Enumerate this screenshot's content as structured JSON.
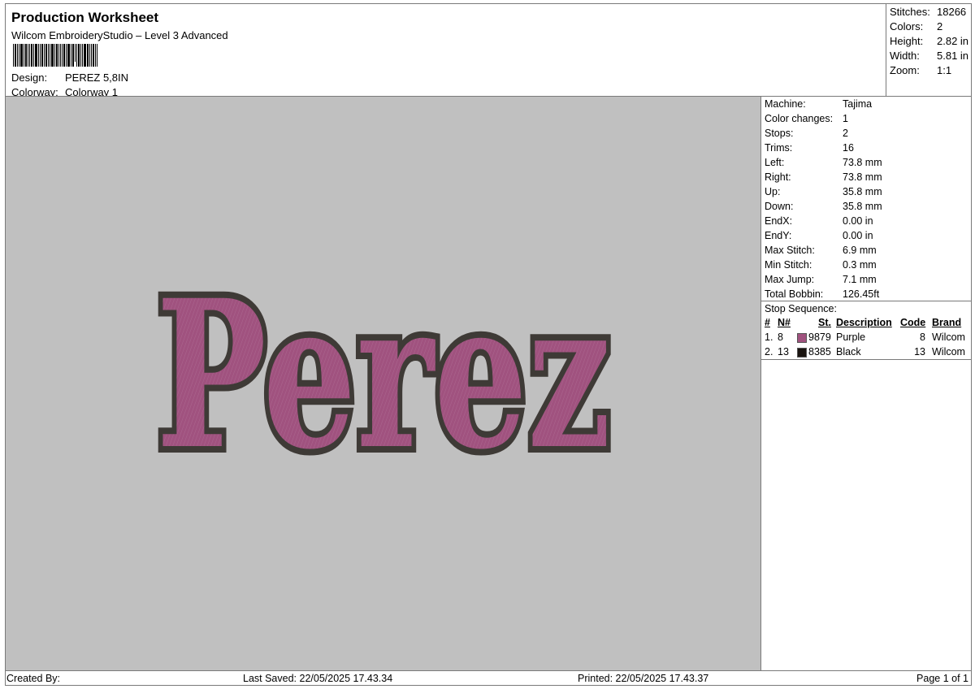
{
  "header": {
    "title": "Production Worksheet",
    "subtitle": "Wilcom EmbroideryStudio – Level 3 Advanced",
    "design_label": "Design:",
    "design_value": "PEREZ 5,8IN",
    "colorway_label": "Colorway:",
    "colorway_value": "Colorway 1"
  },
  "stats": {
    "stitches_label": "Stitches:",
    "stitches": "18266",
    "colors_label": "Colors:",
    "colors": "2",
    "height_label": "Height:",
    "height": "2.82 in",
    "width_label": "Width:",
    "width": "5.81 in",
    "zoom_label": "Zoom:",
    "zoom": "1:1"
  },
  "machine_info": [
    {
      "label": "Machine:",
      "value": "Tajima"
    },
    {
      "label": "Color changes:",
      "value": "1"
    },
    {
      "label": "Stops:",
      "value": "2"
    },
    {
      "label": "Trims:",
      "value": "16"
    },
    {
      "label": "Left:",
      "value": "73.8 mm"
    },
    {
      "label": "Right:",
      "value": "73.8 mm"
    },
    {
      "label": "Up:",
      "value": "35.8 mm"
    },
    {
      "label": "Down:",
      "value": "35.8 mm"
    },
    {
      "label": "EndX:",
      "value": "0.00 in"
    },
    {
      "label": "EndY:",
      "value": "0.00 in"
    },
    {
      "label": "Max Stitch:",
      "value": "6.9 mm"
    },
    {
      "label": "Min Stitch:",
      "value": "0.3 mm"
    },
    {
      "label": "Max Jump:",
      "value": "7.1 mm"
    },
    {
      "label": "Total Bobbin:",
      "value": "126.45ft"
    }
  ],
  "stop_sequence": {
    "title": "Stop Sequence:",
    "columns": [
      "#",
      "N#",
      "St.",
      "Description",
      "Code",
      "Brand"
    ],
    "rows": [
      {
        "num": "1.",
        "n": "8",
        "swatch": "#a0527f",
        "st": "9879",
        "description": "Purple",
        "code": "8",
        "brand": "Wilcom"
      },
      {
        "num": "2.",
        "n": "13",
        "swatch": "#1a1410",
        "st": "8385",
        "description": "Black",
        "code": "13",
        "brand": "Wilcom"
      }
    ]
  },
  "design_text": "Perez",
  "colors": {
    "fill": "#a0527f",
    "outline": "#3e3a36",
    "canvas": "#c0c0c0"
  },
  "footer": {
    "created_by": "Created By:",
    "last_saved": "Last Saved: 22/05/2025 17.43.34",
    "printed": "Printed: 22/05/2025 17.43.37",
    "page": "Page 1 of 1"
  }
}
